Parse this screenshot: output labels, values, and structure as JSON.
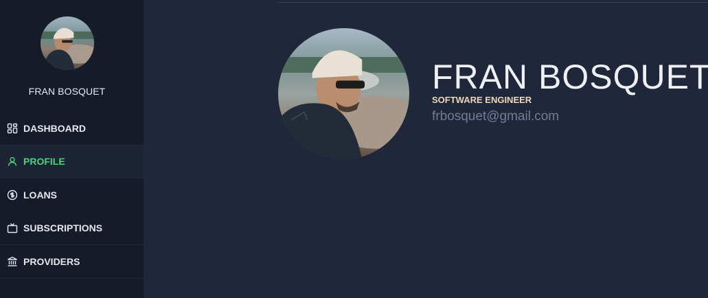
{
  "user": {
    "name": "FRAN BOSQUET",
    "title": "SOFTWARE ENGINEER",
    "email": "frbosquet@gmail.com"
  },
  "sidebar": {
    "items": [
      {
        "label": "DASHBOARD",
        "icon": "dashboard-icon",
        "active": false
      },
      {
        "label": "PROFILE",
        "icon": "user-icon",
        "active": true
      },
      {
        "label": "LOANS",
        "icon": "dollar-circle-icon",
        "active": false
      },
      {
        "label": "SUBSCRIPTIONS",
        "icon": "tv-icon",
        "active": false
      },
      {
        "label": "PROVIDERS",
        "icon": "bank-icon",
        "active": false
      }
    ]
  },
  "colors": {
    "sidebar_bg": "#151b29",
    "main_bg": "#21273a",
    "active_accent": "#4fd07e",
    "role_text": "#ead9bb",
    "email_text": "#6f7e98"
  }
}
